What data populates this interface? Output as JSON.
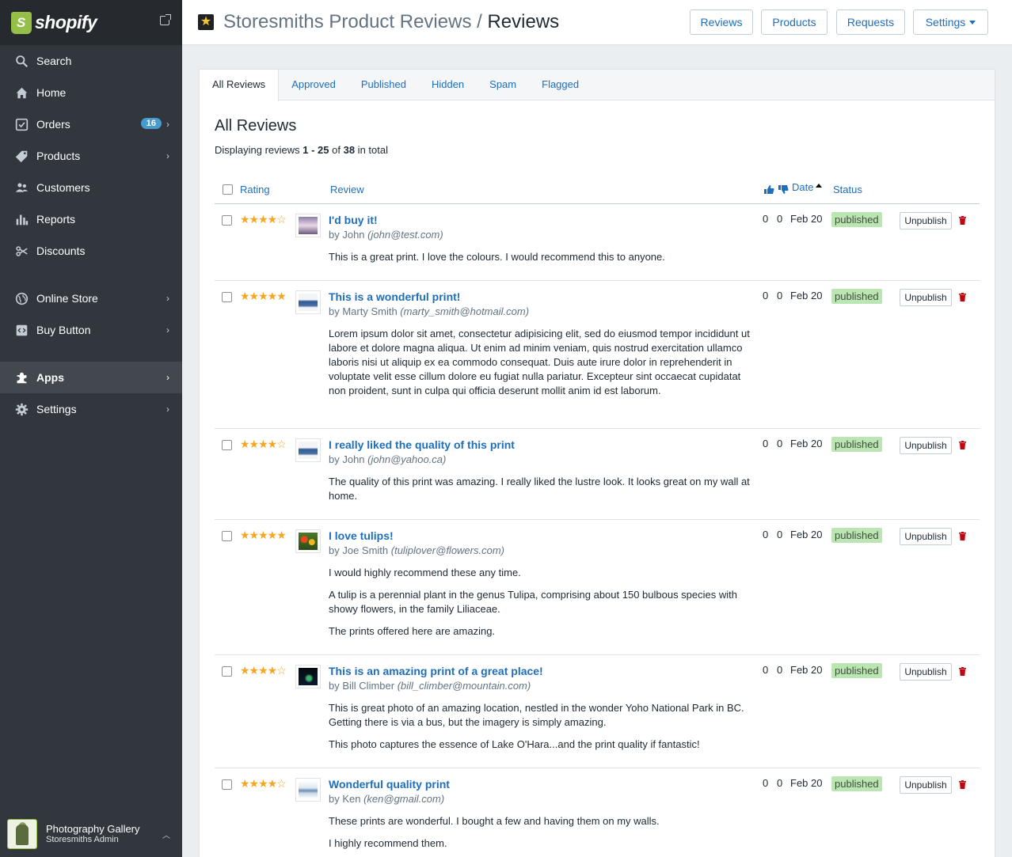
{
  "brand": {
    "name": "shopify"
  },
  "nav": {
    "search": "Search",
    "home": "Home",
    "orders": "Orders",
    "orders_count": "16",
    "products": "Products",
    "customers": "Customers",
    "reports": "Reports",
    "discounts": "Discounts",
    "online_store": "Online Store",
    "buy_button": "Buy Button",
    "apps": "Apps",
    "settings": "Settings"
  },
  "store": {
    "name": "Photography Gallery",
    "subtitle": "Storesmiths Admin"
  },
  "header": {
    "app_name": "Storesmiths Product Reviews",
    "separator": " / ",
    "page": "Reviews",
    "buttons": {
      "reviews": "Reviews",
      "products": "Products",
      "requests": "Requests",
      "settings": "Settings"
    }
  },
  "tabs": {
    "all": "All Reviews",
    "approved": "Approved",
    "published": "Published",
    "hidden": "Hidden",
    "spam": "Spam",
    "flagged": "Flagged"
  },
  "section": {
    "title": "All Reviews",
    "displaying_prefix": "Displaying reviews ",
    "range": "1 - 25",
    "of": " of ",
    "total": "38",
    "suffix": " in total"
  },
  "columns": {
    "rating": "Rating",
    "review": "Review",
    "date": "Date",
    "status": "Status"
  },
  "colors": {
    "accent": "#1e6ebc",
    "published_bg": "#bbe5b3",
    "star": "#f5a623",
    "sidebar": "#31373d"
  },
  "reviews": [
    {
      "stars": "★★★★☆",
      "title": "I'd buy it!",
      "by": "by John ",
      "email": "(john@test.com)",
      "body": [
        "This is a great print. I love the colours. I would recommend this to anyone."
      ],
      "up": "0",
      "down": "0",
      "date": "Feb 20",
      "status": "published",
      "action": "Unpublish"
    },
    {
      "stars": "★★★★★",
      "title": "This is a wonderful print!",
      "by": "by Marty Smith ",
      "email": "(marty_smith@hotmail.com)",
      "body": [
        "Lorem ipsum dolor sit amet, consectetur adipisicing elit, sed do eiusmod tempor incididunt ut labore et dolore magna aliqua. Ut enim ad minim veniam, quis nostrud exercitation ullamco laboris nisi ut aliquip ex ea commodo consequat. Duis aute irure dolor in reprehenderit in voluptate velit esse cillum dolore eu fugiat nulla pariatur. Excepteur sint occaecat cupidatat non proident, sunt in culpa qui officia deserunt mollit anim id est laborum."
      ],
      "up": "0",
      "down": "0",
      "date": "Feb 20",
      "status": "published",
      "action": "Unpublish"
    },
    {
      "stars": "★★★★☆",
      "title": "I really liked the quality of this print",
      "by": "by John ",
      "email": "(john@yahoo.ca)",
      "body": [
        "The quality of this print was amazing. I really liked the lustre look. It looks great on my wall at home."
      ],
      "up": "0",
      "down": "0",
      "date": "Feb 20",
      "status": "published",
      "action": "Unpublish"
    },
    {
      "stars": "★★★★★",
      "title": "I love tulips!",
      "by": "by Joe Smith ",
      "email": "(tuliplover@flowers.com)",
      "body": [
        "I would highly recommend these any time.",
        "A tulip is a perennial plant in the genus Tulipa, comprising about 150 bulbous species with showy flowers, in the family Liliaceae.",
        "The prints offered here are amazing."
      ],
      "up": "0",
      "down": "0",
      "date": "Feb 20",
      "status": "published",
      "action": "Unpublish"
    },
    {
      "stars": "★★★★☆",
      "title": "This is an amazing print of a great place!",
      "by": "by Bill Climber ",
      "email": "(bill_climber@mountain.com)",
      "body": [
        "This is great photo of an amazing location, nestled in the wonder Yoho National Park in BC. Getting there is via a bus, but the imagery is simply amazing.",
        "This photo captures the essence of Lake O'Hara...and the print quality if fantastic!"
      ],
      "up": "0",
      "down": "0",
      "date": "Feb 20",
      "status": "published",
      "action": "Unpublish"
    },
    {
      "stars": "★★★★☆",
      "title": "Wonderful quality print",
      "by": "by Ken ",
      "email": "(ken@gmail.com)",
      "body": [
        "These prints are wonderful. I bought a few and having them on my walls.",
        "I highly recommend them."
      ],
      "up": "0",
      "down": "0",
      "date": "Feb 20",
      "status": "published",
      "action": "Unpublish"
    }
  ]
}
